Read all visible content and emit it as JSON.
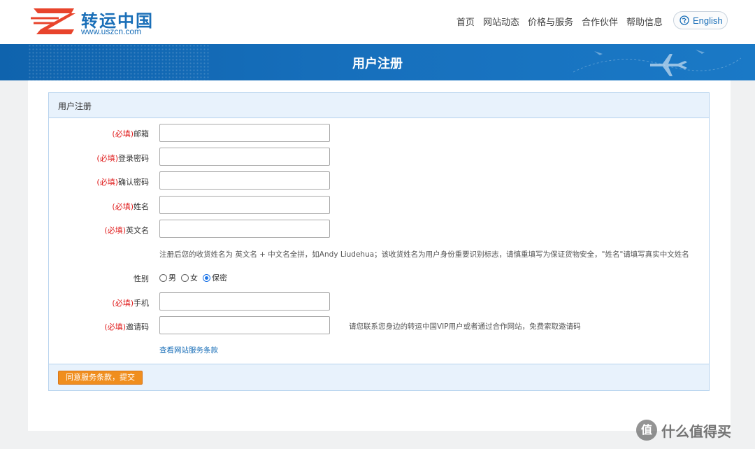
{
  "header": {
    "logo_cn": "转运中国",
    "logo_url": "www.uszcn.com",
    "nav": [
      "首页",
      "网站动态",
      "价格与服务",
      "合作伙伴",
      "帮助信息"
    ],
    "lang": "English"
  },
  "banner": {
    "title": "用户注册"
  },
  "panel": {
    "title": "用户注册",
    "required_tag": "(必填)",
    "labels": {
      "email": "邮箱",
      "password": "登录密码",
      "confirm": "确认密码",
      "name": "姓名",
      "en_name": "英文名",
      "gender": "性别",
      "phone": "手机",
      "invite": "邀请码"
    },
    "name_hint": "注册后您的收货姓名为 英文名 + 中文名全拼，如Andy Liudehua；该收货姓名为用户身份重要识别标志，请慎重填写为保证货物安全，\"姓名\"请填写真实中文姓名",
    "gender_options": [
      "男",
      "女",
      "保密"
    ],
    "gender_selected": "保密",
    "invite_hint": "请您联系您身边的转运中国VIP用户或者通过合作网站，免费索取邀请码",
    "terms_link": "查看网站服务条款",
    "submit": "同意服务条款，提交"
  },
  "watermark": {
    "icon_text": "值",
    "text": "什么值得买"
  },
  "colors": {
    "brand_blue": "#1770bd",
    "accent_orange": "#f08e1e",
    "required_red": "#e02020"
  }
}
